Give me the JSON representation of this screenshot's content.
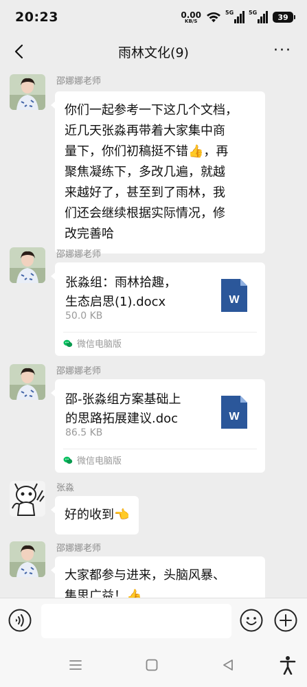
{
  "status_bar": {
    "time": "20:23",
    "net_speed_value": "0.00",
    "net_speed_unit": "KB/S",
    "signal_1_label": "5G",
    "signal_2_label": "5G",
    "battery_level": "39"
  },
  "nav": {
    "title": "雨林文化(9)",
    "more": "···"
  },
  "messages": [
    {
      "sender": "邵娜娜老师",
      "type": "text",
      "text_lines": [
        "你们一起参考一下这几个文档，",
        "近几天张淼再带着大家集中商",
        "量下，你们初稿挺不错👍，再",
        "聚焦凝练下，多改几遍，就越",
        "来越好了，甚至到了雨林，我",
        "们还会继续根据实际情况，修",
        "改完善哈"
      ]
    },
    {
      "sender": "邵娜娜老师",
      "type": "file",
      "file_name_lines": [
        "张淼组：雨林拾趣，",
        "生态启思(1).docx"
      ],
      "file_size": "50.0 KB",
      "source": "微信电脑版",
      "icon_letter": "W"
    },
    {
      "sender": "邵娜娜老师",
      "type": "file",
      "file_name_lines": [
        "邵-张淼组方案基础上",
        "的思路拓展建议.doc"
      ],
      "file_size": "86.5 KB",
      "source": "微信电脑版",
      "icon_letter": "W"
    },
    {
      "sender": "张淼",
      "type": "text",
      "text_lines": [
        "好的收到👈"
      ]
    },
    {
      "sender": "邵娜娜老师",
      "type": "text",
      "text_lines": [
        "大家都参与进来，头脑风暴、",
        "集思广益！👍"
      ]
    }
  ],
  "input_bar": {
    "placeholder": ""
  },
  "colors": {
    "background": "#ededed",
    "bubble": "#ffffff",
    "word_blue": "#2b579a",
    "wechat_green": "#07c160"
  }
}
